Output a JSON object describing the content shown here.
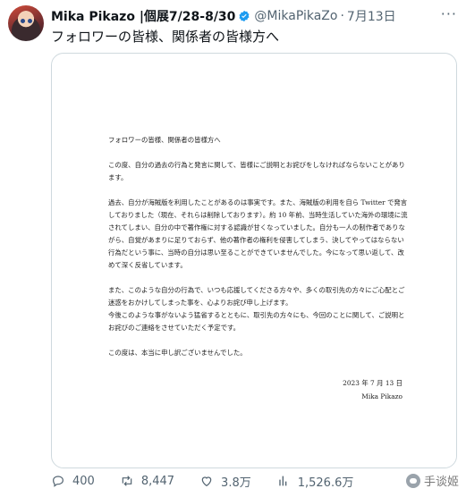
{
  "tweet": {
    "author_name": "Mika Pikazo |個展7/28-8/30",
    "handle": "@MikaPikaZo",
    "separator": "·",
    "date": "7月13日",
    "more": "···",
    "text": "フォロワーの皆様、関係者の皆様方へ"
  },
  "letter": {
    "salutation": "フォロワーの皆様、関係者の皆様方へ",
    "paragraph1": "この度、自分の過去の行為と発言に関して、皆様にご説明とお詫びをしなければならないことがあります。",
    "paragraph2": "過去、自分が海賊版を利用したことがあるのは事実です。また、海賊版の利用を自ら Twitter で発言しておりました（現在、それらは削除しております）。約 10 年前、当時生活していた海外の環境に流されてしまい、自分の中で著作権に対する認識が甘くなっていました。自分も一人の制作者でありながら、自覚があまりに足りておらず、他の著作者の権利を侵害してしまう、決してやってはならない行為だという事に、当時の自分は思い至ることができていませんでした。今になって思い返して、改めて深く反省しています。",
    "paragraph3": "また、このような自分の行為で、いつも応援してくださる方々や、多くの取引先の方々にご心配とご迷惑をおかけしてしまった事を、心よりお詫び申し上げます。",
    "paragraph4": "今後このような事がないよう猛省するとともに、取引先の方々にも、今回のことに関して、ご説明とお詫びのご連絡をさせていただく予定です。",
    "closing": "この度は、本当に申し訳ございませんでした。",
    "date": "2023 年 7 月 13 日",
    "signature": "Mika Pikazo"
  },
  "actions": {
    "replies": "400",
    "retweets": "8,447",
    "likes": "3.8万",
    "views": "1,526.6万"
  },
  "watermark": "手谈姬",
  "colors": {
    "verified": "#1d9bf0",
    "secondary_text": "#536471",
    "border": "#cfd9de"
  }
}
